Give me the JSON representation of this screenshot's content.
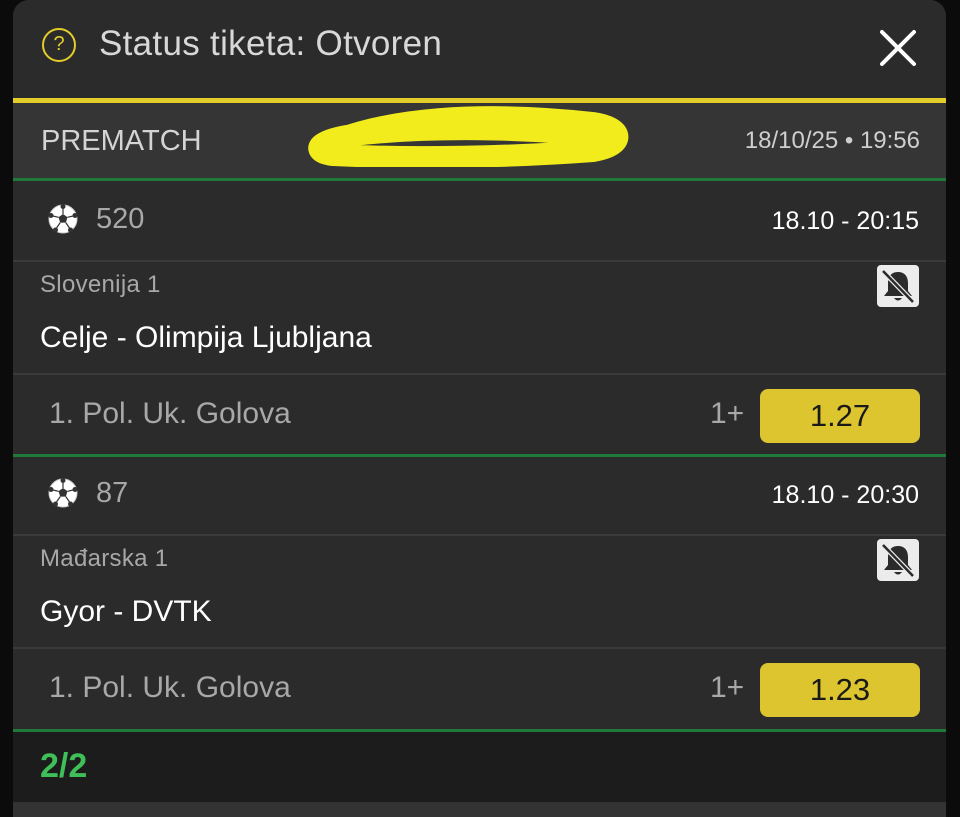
{
  "header": {
    "help_icon_glyph": "?",
    "title": "Status tiketa: Otvoren",
    "close_icon": "close-x-icon",
    "accent_color": "#e3cd2a"
  },
  "ticket": {
    "type_label": "PREMATCH",
    "created": "18/10/25 • 19:56"
  },
  "events": [
    {
      "code": "520",
      "time": "18.10  -  20:15",
      "league": "Slovenija 1",
      "match": "Celje - Olimpija Ljubljana",
      "market": "1. Pol. Uk. Golova",
      "pick": "1+",
      "odds": "1.27"
    },
    {
      "code": "87",
      "time": "18.10  -  20:30",
      "league": "Mađarska 1",
      "match": "Gyor - DVTK",
      "market": "1. Pol. Uk. Golova",
      "pick": "1+",
      "odds": "1.23"
    }
  ],
  "footer": {
    "count": "2/2",
    "count_color": "#3fbf58"
  }
}
